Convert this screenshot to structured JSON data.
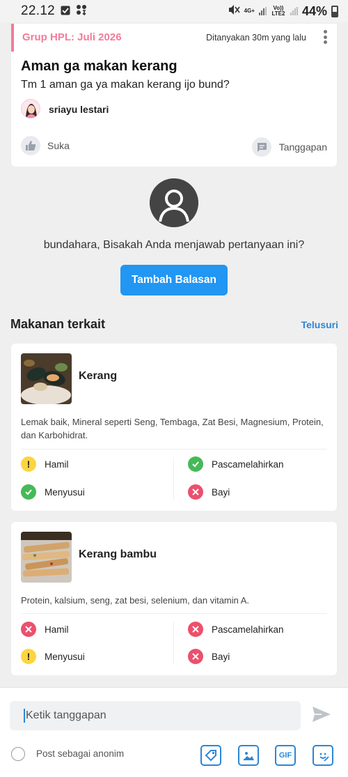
{
  "status_bar": {
    "time": "22.12",
    "network_4g": "4G+",
    "network_volte": "Vo)) LTE2",
    "battery": "44%"
  },
  "question": {
    "group": "Grup HPL: Juli 2026",
    "asked_time": "Ditanyakan 30m yang lalu",
    "title": "Aman ga makan kerang",
    "body": "Tm 1 aman ga ya makan kerang ijo bund?",
    "author": "sriayu lestari",
    "like_label": "Suka",
    "reply_label": "Tanggapan"
  },
  "answer_prompt": {
    "text": "bundahara, Bisakah Anda menjawab pertanyaan ini?",
    "button": "Tambah Balasan"
  },
  "related": {
    "title": "Makanan terkait",
    "link": "Telusuri",
    "items": [
      {
        "name": "Kerang",
        "description": "Lemak baik, Mineral seperti Seng, Tembaga, Zat Besi, Magnesium, Protein, dan Karbohidrat.",
        "statuses": [
          {
            "label": "Hamil",
            "status": "warning"
          },
          {
            "label": "Pascamelahirkan",
            "status": "safe"
          },
          {
            "label": "Menyusui",
            "status": "safe"
          },
          {
            "label": "Bayi",
            "status": "unsafe"
          }
        ]
      },
      {
        "name": "Kerang bambu",
        "description": "Protein, kalsium, seng, zat besi, selenium, dan vitamin A.",
        "statuses": [
          {
            "label": "Hamil",
            "status": "unsafe"
          },
          {
            "label": "Pascamelahirkan",
            "status": "unsafe"
          },
          {
            "label": "Menyusui",
            "status": "warning"
          },
          {
            "label": "Bayi",
            "status": "unsafe"
          }
        ]
      }
    ]
  },
  "composer": {
    "placeholder": "Ketik tanggapan",
    "anonymous_label": "Post sebagai anonim",
    "tools": [
      "tag-icon",
      "image-icon",
      "gif-icon",
      "sticker-icon"
    ],
    "gif_label": "GIF"
  },
  "colors": {
    "accent_pink": "#f37b98",
    "primary_blue": "#2196f3",
    "link_blue": "#2b86d6",
    "safe_green": "#46b958",
    "warn_yellow": "#fcd53f",
    "unsafe_red": "#ec506d"
  }
}
